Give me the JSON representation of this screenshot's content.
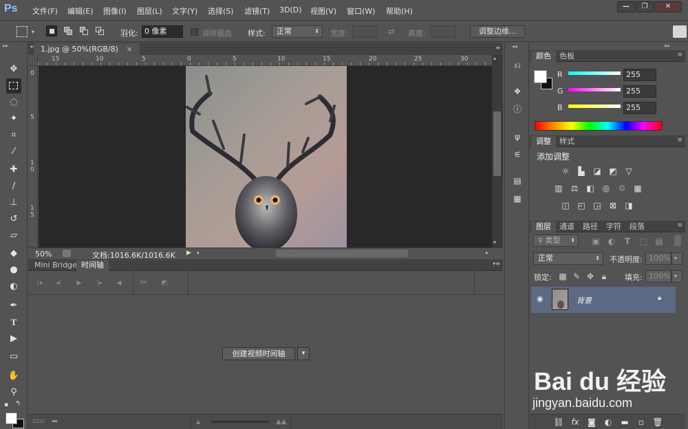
{
  "app": {
    "logo": "Ps"
  },
  "menu": [
    "文件(F)",
    "编辑(E)",
    "图像(I)",
    "图层(L)",
    "文字(Y)",
    "选择(S)",
    "滤镜(T)",
    "3D(D)",
    "视图(V)",
    "窗口(W)",
    "帮助(H)"
  ],
  "window_controls": {
    "minimize": "—",
    "restore": "❐",
    "close": "✕"
  },
  "options": {
    "feather_label": "羽化:",
    "feather_value": "0 像素",
    "antialias_label": "消除锯齿",
    "style_label": "样式:",
    "style_value": "正常",
    "width_label": "宽度:",
    "height_label": "高度:",
    "refine_edge_button": "调整边缘..."
  },
  "document": {
    "tab_title": "1.jpg @ 50%(RGB/8)",
    "tab_close": "×",
    "ruler_top_labels": [
      "15",
      "10",
      "5",
      "0",
      "5",
      "10",
      "15",
      "20",
      "25",
      "30"
    ],
    "ruler_left_labels": [
      "0",
      "5",
      "1",
      "0",
      "1",
      "5"
    ],
    "zoom": "50%",
    "doc_info": "文档:1016.6K/1016.6K"
  },
  "timeline": {
    "tabs": [
      "Mini Bridge",
      "时间轴"
    ],
    "create_button": "创建视频时间轴",
    "dropdown_glyph": "▾"
  },
  "color_panel": {
    "tabs": [
      "颜色",
      "色板"
    ],
    "channels": [
      {
        "label": "R",
        "value": "255"
      },
      {
        "label": "G",
        "value": "255"
      },
      {
        "label": "B",
        "value": "255"
      }
    ]
  },
  "adjustments_panel": {
    "tabs": [
      "调整",
      "样式"
    ],
    "title": "添加调整"
  },
  "layers_panel": {
    "tabs": [
      "图层",
      "通道",
      "路径",
      "字符",
      "段落"
    ],
    "filter_label": "类型",
    "blend_mode": "正常",
    "opacity_label": "不透明度:",
    "opacity_value": "100%",
    "lock_label": "锁定:",
    "fill_label": "填充:",
    "fill_value": "100%",
    "layers": [
      {
        "name": "背景",
        "visible": true,
        "locked": true
      }
    ]
  },
  "watermark": {
    "brand": "Bai du 经验",
    "url": "jingyan.baidu.com"
  },
  "colors": {
    "accent": "#5b6a82",
    "logo": "#8fc3ff",
    "canvas_bg": "#282828",
    "panel_bg": "#535353"
  }
}
